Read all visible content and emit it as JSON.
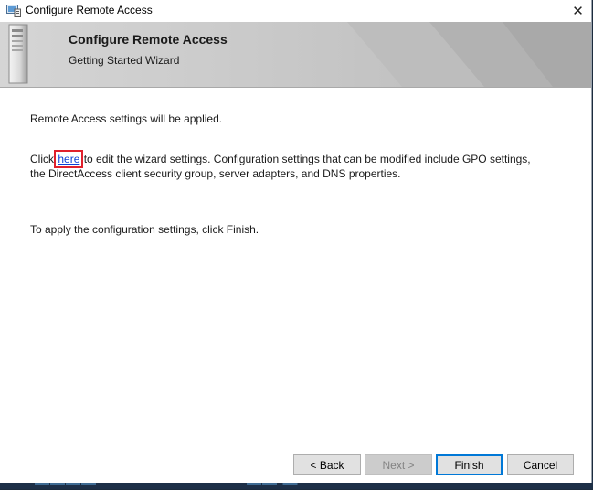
{
  "window": {
    "title": "Configure Remote Access",
    "close_glyph": "✕",
    "app_icon": "remote-access-icon"
  },
  "banner": {
    "title": "Configure Remote Access",
    "subtitle": "Getting Started Wizard",
    "icon": "server-icon"
  },
  "content": {
    "line1": "Remote Access settings will be applied.",
    "line2_prefix": "Click ",
    "line2_link": "here",
    "line2_suffix": " to edit the wizard settings. Configuration settings that can be modified include GPO settings,",
    "line3": "the DirectAccess client security group, server adapters, and DNS properties.",
    "line4": "To apply the configuration settings, click Finish."
  },
  "buttons": {
    "back": "< Back",
    "next": "Next >",
    "finish": "Finish",
    "cancel": "Cancel"
  },
  "colors": {
    "link": "#0b3fd6",
    "highlight_box": "#e0202c",
    "default_button_border": "#0078d7"
  }
}
